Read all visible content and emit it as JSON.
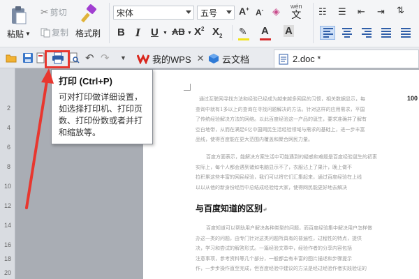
{
  "ribbon": {
    "paste_label": "粘贴",
    "cut_label": "剪切",
    "copy_label": "复制",
    "format_painter_label": "格式刷",
    "font_name": "宋体",
    "font_size": "五号",
    "wen_glyph": "wén"
  },
  "tabs": [
    {
      "label": "我的WPS"
    },
    {
      "label": "云文档"
    },
    {
      "label": "2.doc *"
    }
  ],
  "tooltip": {
    "title": "打印 (Ctrl+P)",
    "body": "可对打印做详细设置，如选择打印机、打印页数、打印份数或者并打和缩放等。"
  },
  "document": {
    "page_number_label": "100",
    "heading": "与百度知道的区别",
    "paragraphs": [
      "通过互联网寻找方法和经验已经成为越来越多网民的习惯，相关数据显示，每",
      "查询中就有1多以上的查询在寻找问题解决的方法。针对这样的应用需求，平国",
      "了传统经验解决方法的网络。以此百度经验这一产品的诞生，要求准确并了解有",
      "空白地带，从而在满足6亿中国网民生活经验领域与需求的基础上，进一步丰富",
      "品线，使得百度能在更大范围内覆盖和聚合网民力量。",
      "百度方面表示，能解决方案生活中可能遇到的疑惑和难题是百度经验诞生的初衷",
      "实际上，每个人都会遇到诸如电脑显示不了，衣服沾上了果汁，晚上做不",
      "拉积累这些丰富的网民经验，我们可以将它们汇集起来，通过百度经验在上线",
      "以以从他的新身份经历中总结成经验给大家，使得网民能更好地去解决",
      "百度知道可以帮助用户解决各种类型的问题，而百度经验集中解决用户怎样做",
      "办这一类的问题，由专门针对这类问题所具有的普遍性，过程性的特点，提供",
      "决，学习和尝试的解答形式。一篇经验文章中，经验作者的分享内容包括",
      "注意事项，参考资料等几个部分，一般都会有丰富的图片描述和步骤提示",
      "作，一步步操作直至完成，但百度经验中建议的方法是经过经验作者实践验证的"
    ]
  },
  "ruler": {
    "ticks": [
      "2",
      "4",
      "6",
      "8",
      "10",
      "12",
      "14",
      "16",
      "18",
      "20"
    ]
  },
  "colors": {
    "accent": "#e8372f",
    "ribbon_bg": "#f4f5f7",
    "canvas_bg": "#a9adb4"
  }
}
